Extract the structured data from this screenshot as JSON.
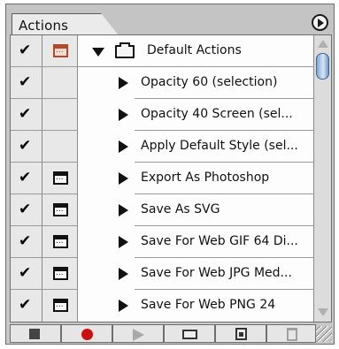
{
  "palette": {
    "tab_label": "Actions",
    "menu_icon": "palette-menu-arrow-icon"
  },
  "actions": {
    "set_name": "Default Actions",
    "items": [
      {
        "label": "Opacity 60 (selection)",
        "checked": true,
        "dialog": false
      },
      {
        "label": "Opacity 40 Screen (sel...",
        "checked": true,
        "dialog": false
      },
      {
        "label": "Apply Default Style (sel...",
        "checked": true,
        "dialog": false
      },
      {
        "label": "Export As Photoshop",
        "checked": true,
        "dialog": true
      },
      {
        "label": "Save As SVG",
        "checked": true,
        "dialog": true
      },
      {
        "label": "Save For Web GIF 64 Di...",
        "checked": true,
        "dialog": true
      },
      {
        "label": "Save For Web JPG Med...",
        "checked": true,
        "dialog": true
      },
      {
        "label": "Save For Web PNG 24",
        "checked": true,
        "dialog": true
      }
    ]
  },
  "glyphs": {
    "check": "✔"
  },
  "toolbar": {
    "buttons": [
      "stop-playing-icon",
      "begin-recording-icon",
      "play-selection-icon",
      "create-new-set-icon",
      "create-new-action-icon",
      "delete-selection-icon"
    ]
  },
  "colors": {
    "record_red": "#cc1010",
    "dialog_accent": "#b04a2a",
    "scroll_thumb": "#7ea6d8"
  }
}
